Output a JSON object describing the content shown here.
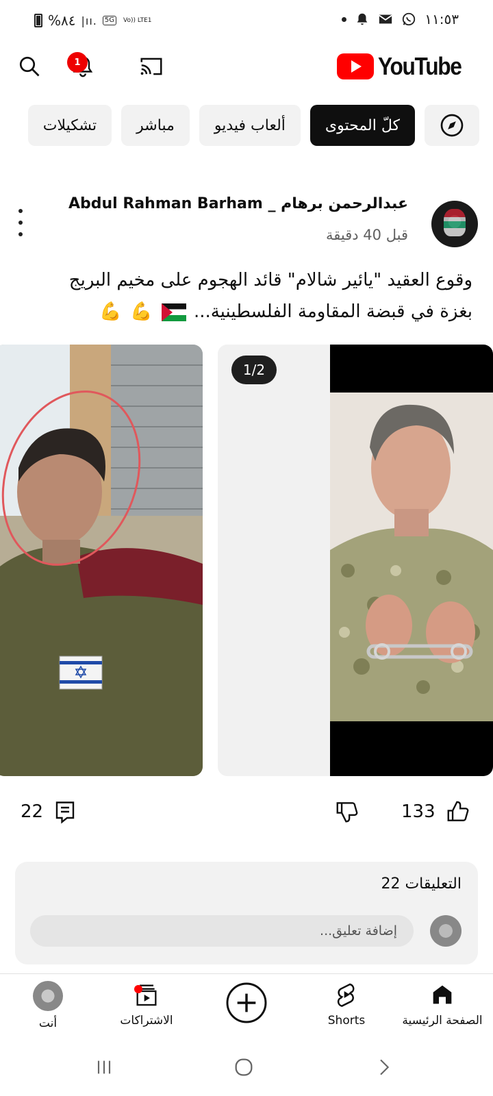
{
  "status_bar": {
    "battery": "%٨٤",
    "network": "5G",
    "volte": "Vo)) LTE1",
    "time": "١١:٥٣"
  },
  "app": {
    "logo_text": "YouTube",
    "notification_count": "1",
    "brand_color": "#ff0000"
  },
  "chips": [
    {
      "label": "",
      "icon": "compass-icon"
    },
    {
      "label": "كلّ المحتوى",
      "active": true
    },
    {
      "label": "ألعاب فيديو"
    },
    {
      "label": "مباشر"
    },
    {
      "label": "تشكيلات"
    }
  ],
  "post": {
    "author": "عبدالرحمن برهام _ Abdul Rahman Barham",
    "time": "قبل 40 دقيقة",
    "text_line1": "وقوع العقيد \"يائير شالام\" قائد الهجوم على مخيم البريج",
    "text_line2": "بغزة في قبضة المقاومة الفلسطينية...",
    "image_counter": "1/2",
    "likes": "133",
    "comments_count": "22"
  },
  "comments": {
    "title": "التعليقات 22",
    "placeholder": "إضافة تعليق..."
  },
  "bottom_nav": [
    {
      "label": "الصفحة الرئيسية",
      "icon": "home-icon"
    },
    {
      "label": "Shorts",
      "icon": "shorts-icon"
    },
    {
      "label": "",
      "icon": "create-icon"
    },
    {
      "label": "الاشتراكات",
      "icon": "subscriptions-icon"
    },
    {
      "label": "أنت",
      "icon": "avatar"
    }
  ]
}
